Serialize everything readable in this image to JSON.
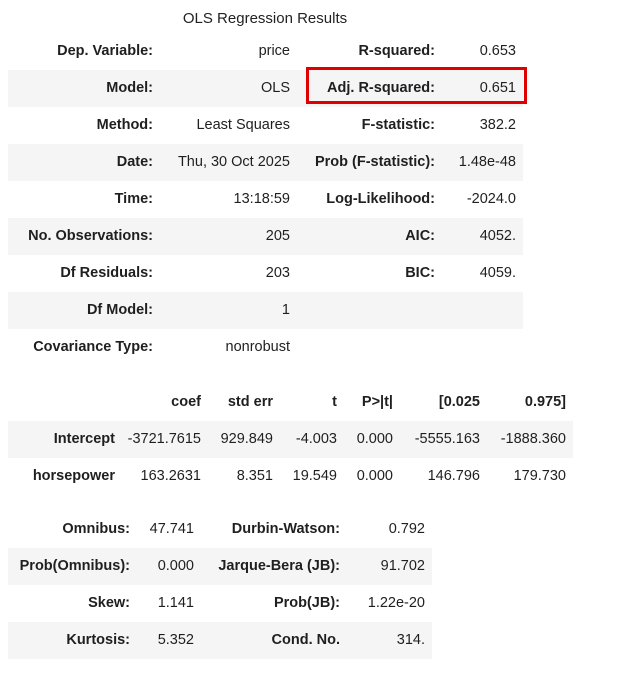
{
  "caption": "OLS Regression Results",
  "summary": [
    {
      "l1": "Dep. Variable:",
      "v1": "price",
      "l2": "R-squared:",
      "v2": "0.653"
    },
    {
      "l1": "Model:",
      "v1": "OLS",
      "l2": "Adj. R-squared:",
      "v2": "0.651"
    },
    {
      "l1": "Method:",
      "v1": "Least Squares",
      "l2": "F-statistic:",
      "v2": "382.2"
    },
    {
      "l1": "Date:",
      "v1": "Thu, 30 Oct 2025",
      "l2": "Prob (F-statistic):",
      "v2": "1.48e-48"
    },
    {
      "l1": "Time:",
      "v1": "13:18:59",
      "l2": "Log-Likelihood:",
      "v2": "-2024.0"
    },
    {
      "l1": "No. Observations:",
      "v1": "205",
      "l2": "AIC:",
      "v2": "4052."
    },
    {
      "l1": "Df Residuals:",
      "v1": "203",
      "l2": "BIC:",
      "v2": "4059."
    },
    {
      "l1": "Df Model:",
      "v1": "1",
      "l2": "",
      "v2": ""
    },
    {
      "l1": "Covariance Type:",
      "v1": "nonrobust",
      "l2": "",
      "v2": ""
    }
  ],
  "coef_table": {
    "headers": [
      "",
      "coef",
      "std err",
      "t",
      "P>|t|",
      "[0.025",
      "0.975]"
    ],
    "rows": [
      [
        "Intercept",
        "-3721.7615",
        "929.849",
        "-4.003",
        "0.000",
        "-5555.163",
        "-1888.360"
      ],
      [
        "horsepower",
        "163.2631",
        "8.351",
        "19.549",
        "0.000",
        "146.796",
        "179.730"
      ]
    ]
  },
  "diagnostics": [
    {
      "l1": "Omnibus:",
      "v1": "47.741",
      "l2": "Durbin-Watson:",
      "v2": "0.792"
    },
    {
      "l1": "Prob(Omnibus):",
      "v1": "0.000",
      "l2": "Jarque-Bera (JB):",
      "v2": "91.702"
    },
    {
      "l1": "Skew:",
      "v1": "1.141",
      "l2": "Prob(JB):",
      "v2": "1.22e-20"
    },
    {
      "l1": "Kurtosis:",
      "v1": "5.352",
      "l2": "Cond. No.",
      "v2": "314."
    }
  ],
  "highlight_color": "#e00000"
}
